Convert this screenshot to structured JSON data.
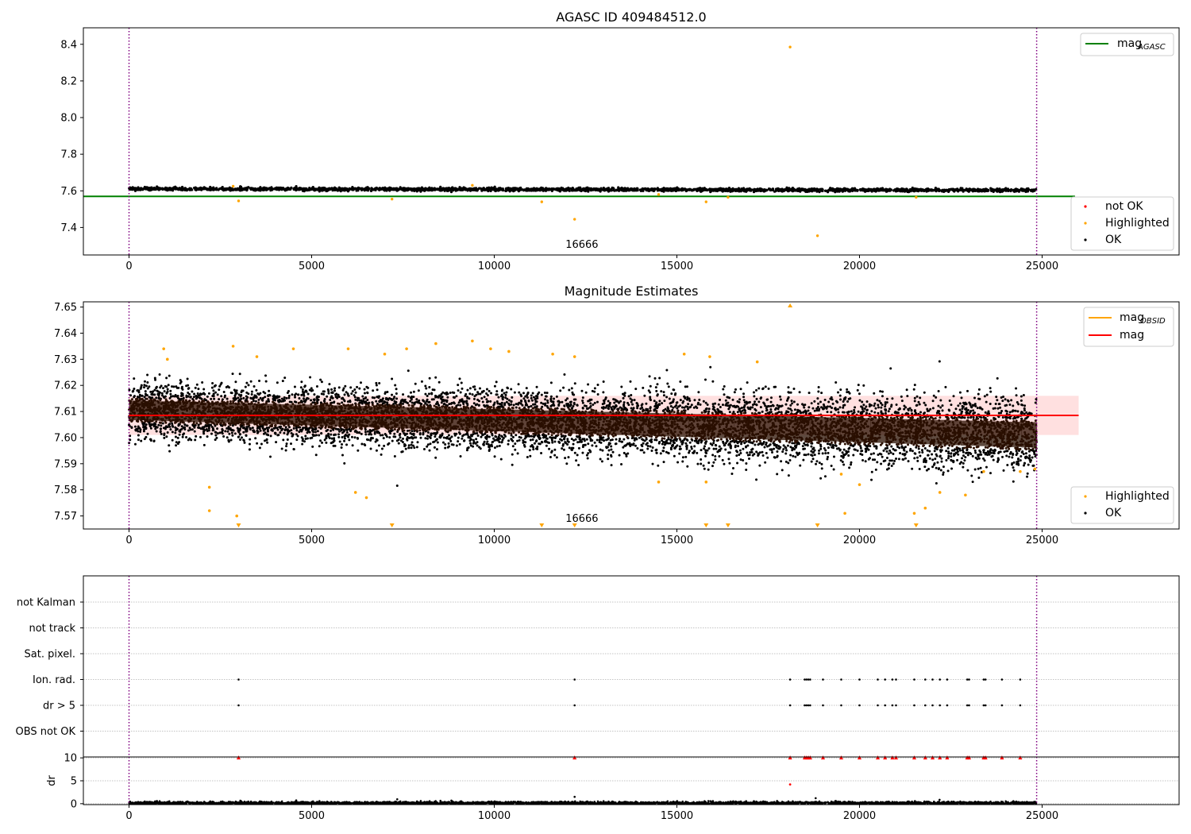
{
  "chart_data": [
    {
      "type": "scatter",
      "title": "AGASC ID 409484512.0",
      "xlabel": "",
      "ylabel": "",
      "xlim": [
        -1250,
        28750
      ],
      "ylim": [
        7.25,
        8.49
      ],
      "xticks": [
        0,
        5000,
        10000,
        15000,
        20000,
        25000
      ],
      "yticks": [
        7.4,
        7.6,
        7.8,
        8.0,
        8.2,
        8.4
      ],
      "vlines": [
        0,
        24850
      ],
      "annotation": "16666",
      "reference_lines": [
        {
          "name": "mag_AGASC",
          "y": 7.57,
          "x_range": [
            -1250,
            25900
          ],
          "color": "#008000"
        }
      ],
      "legend_upper": {
        "position": "top-right",
        "entries": [
          {
            "label": "mag",
            "sub": "AGASC",
            "color": "#008000"
          }
        ]
      },
      "legend_lower": {
        "position": "bottom-right",
        "entries": [
          {
            "label": "not OK",
            "color": "#ff0000"
          },
          {
            "label": "Highlighted",
            "color": "#ffa500"
          },
          {
            "label": "OK",
            "color": "#000000"
          }
        ]
      },
      "ok_band": {
        "x_range": [
          0,
          24850
        ],
        "center_start": 7.611,
        "center_end": 7.603,
        "spread": 0.012
      },
      "highlighted_points": [
        [
          2850,
          7.625
        ],
        [
          3000,
          7.545
        ],
        [
          7200,
          7.555
        ],
        [
          9400,
          7.63
        ],
        [
          11300,
          7.54
        ],
        [
          12200,
          7.445
        ],
        [
          14500,
          7.58
        ],
        [
          15800,
          7.54
        ],
        [
          16400,
          7.565
        ],
        [
          18100,
          8.385
        ],
        [
          18850,
          7.355
        ],
        [
          21550,
          7.565
        ]
      ],
      "not_ok_points": []
    },
    {
      "type": "scatter",
      "title": "Magnitude Estimates",
      "xlabel": "",
      "ylabel": "",
      "xlim": [
        -1250,
        28750
      ],
      "ylim": [
        7.565,
        7.652
      ],
      "xticks": [
        0,
        5000,
        10000,
        15000,
        20000,
        25000
      ],
      "yticks": [
        7.57,
        7.58,
        7.59,
        7.6,
        7.61,
        7.62,
        7.63,
        7.64,
        7.65
      ],
      "vlines": [
        0,
        24850
      ],
      "annotation": "16666",
      "mag_line": {
        "name": "mag",
        "y": 7.6085,
        "x_range": [
          0,
          26000
        ],
        "color": "#ff0000"
      },
      "mag_band": {
        "low": 7.601,
        "high": 7.616,
        "x_range": [
          0,
          26000
        ]
      },
      "legend_upper": {
        "position": "top-right",
        "entries": [
          {
            "label": "mag",
            "sub": "OBSID",
            "color": "#ffa500"
          },
          {
            "label": "mag",
            "sub": "",
            "color": "#ff0000"
          }
        ]
      },
      "legend_lower": {
        "position": "bottom-right",
        "entries": [
          {
            "label": "Highlighted",
            "color": "#ffa500"
          },
          {
            "label": "OK",
            "color": "#000000"
          }
        ]
      },
      "ok_distribution": {
        "x_range": [
          0,
          24850
        ],
        "mean_start": 7.6105,
        "mean_end": 7.601,
        "sigma_start": 0.005,
        "sigma_end": 0.0065
      },
      "highlighted_points": [
        [
          950,
          7.634
        ],
        [
          1050,
          7.63
        ],
        [
          2200,
          7.581
        ],
        [
          2200,
          7.572
        ],
        [
          2850,
          7.635
        ],
        [
          2950,
          7.57
        ],
        [
          3500,
          7.631
        ],
        [
          4500,
          7.634
        ],
        [
          6000,
          7.634
        ],
        [
          6200,
          7.579
        ],
        [
          6500,
          7.577
        ],
        [
          7000,
          7.632
        ],
        [
          7600,
          7.634
        ],
        [
          8400,
          7.636
        ],
        [
          9400,
          7.637
        ],
        [
          9900,
          7.634
        ],
        [
          10400,
          7.633
        ],
        [
          11600,
          7.632
        ],
        [
          12200,
          7.631
        ],
        [
          14500,
          7.583
        ],
        [
          15200,
          7.632
        ],
        [
          15800,
          7.583
        ],
        [
          15900,
          7.631
        ],
        [
          17200,
          7.629
        ],
        [
          19500,
          7.586
        ],
        [
          19600,
          7.571
        ],
        [
          20000,
          7.582
        ],
        [
          21500,
          7.571
        ],
        [
          21800,
          7.573
        ],
        [
          22200,
          7.579
        ],
        [
          22900,
          7.578
        ],
        [
          23400,
          7.587
        ],
        [
          24400,
          7.587
        ],
        [
          24800,
          7.588
        ]
      ],
      "clipped_low_markers": [
        3000,
        7200,
        11300,
        12200,
        15800,
        16400,
        18850,
        21550
      ],
      "clipped_high_markers": [
        18100
      ]
    },
    {
      "type": "scatter",
      "title": "",
      "categories": [
        "not Kalman",
        "not track",
        "Sat. pixel.",
        "Ion. rad.",
        "dr > 5",
        "OBS not OK"
      ],
      "xlim": [
        -1250,
        28750
      ],
      "xticks": [
        0,
        5000,
        10000,
        15000,
        20000,
        25000
      ],
      "vlines": [
        0,
        24850
      ],
      "flag_points": {
        "Ion. rad.": [
          3000,
          12200,
          18100,
          18500,
          18550,
          18600,
          18650,
          19000,
          19500,
          20000,
          20500,
          20700,
          20900,
          21000,
          21500,
          21800,
          22000,
          22200,
          22400,
          22950,
          23000,
          23400,
          23450,
          23900,
          24400
        ],
        "dr > 5": [
          3000,
          12200,
          18100,
          18500,
          18550,
          18600,
          18650,
          19000,
          19500,
          20000,
          20500,
          20700,
          20900,
          21000,
          21500,
          21800,
          22000,
          22200,
          22400,
          22950,
          23000,
          23400,
          23450,
          23900,
          24400
        ]
      }
    },
    {
      "type": "scatter",
      "title": "",
      "ylabel": "dr",
      "xlim": [
        -1250,
        28750
      ],
      "ylim": [
        -0.2,
        10.2
      ],
      "xticks": [
        0,
        5000,
        10000,
        15000,
        20000,
        25000
      ],
      "yticks": [
        0,
        5,
        10
      ],
      "vlines": [
        0,
        24850
      ],
      "clipped_high_markers": [
        3000,
        12200,
        18100,
        18500,
        18550,
        18600,
        18650,
        19000,
        19500,
        20000,
        20500,
        20700,
        20900,
        21000,
        21500,
        21800,
        22000,
        22200,
        22400,
        22950,
        23000,
        23400,
        23450,
        23900,
        24400
      ],
      "red_points": [
        [
          18100,
          4.2
        ]
      ],
      "black_points": [
        [
          12200,
          1.5
        ],
        [
          18800,
          1.2
        ]
      ],
      "baseline": {
        "x_range": [
          0,
          24850
        ],
        "typical": 0.2
      }
    }
  ],
  "colors": {
    "ok": "#000000",
    "highlighted": "#ffa500",
    "not_ok": "#ff0000",
    "vline": "#800080",
    "agasc_line": "#008000",
    "mag_line": "#ff0000",
    "obsid_line": "#ffa500",
    "band_fill": "#ffcccc",
    "dense_core": "#2a0f00",
    "grid": "#b0b0b0"
  }
}
